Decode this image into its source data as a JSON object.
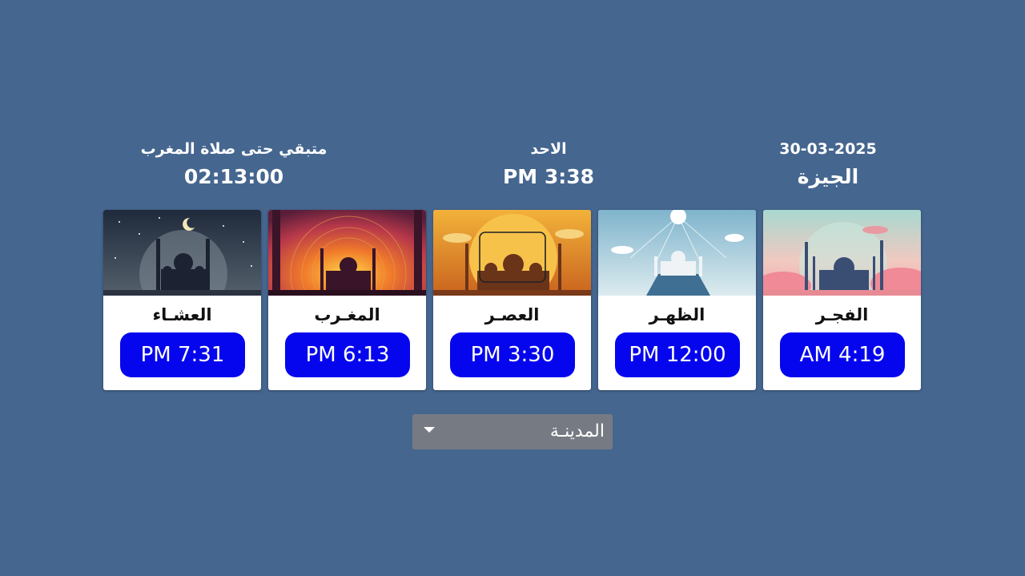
{
  "header": {
    "date": "30-03-2025",
    "city": "الجيزة",
    "day": "الاحد",
    "current_time": "PM 3:38",
    "remaining_label": "متبقي حتى صلاة المغرب",
    "remaining_time": "02:13:00"
  },
  "prayers": [
    {
      "name": "الفجـر",
      "time": "AM 4:19",
      "icon": "fajr-mosque-image"
    },
    {
      "name": "الظهـر",
      "time": "PM 12:00",
      "icon": "dhuhr-mosque-image"
    },
    {
      "name": "العصـر",
      "time": "PM 3:30",
      "icon": "asr-mosque-image"
    },
    {
      "name": "المغـرب",
      "time": "PM 6:13",
      "icon": "maghrib-mosque-image"
    },
    {
      "name": "العشـاء",
      "time": "PM 7:31",
      "icon": "isha-mosque-image"
    }
  ],
  "city_select": {
    "label": "المدينـة",
    "icon": "caret-down-icon"
  },
  "colors": {
    "background": "#45668f",
    "time_button": "#0606ee",
    "select_bg": "#767b83"
  }
}
